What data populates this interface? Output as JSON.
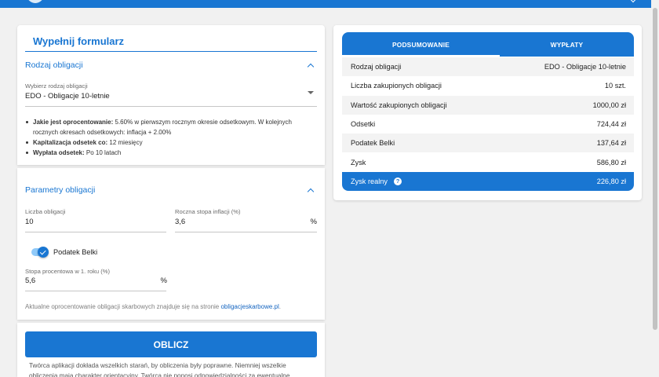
{
  "theme": {
    "primary": "#1976d2",
    "primary_light": "#90caf9",
    "page_background": "#f1f1f1",
    "link": "#1565c0"
  },
  "header": {
    "logo_icon": "logo-icon",
    "menu_icon": "chevron-down-icon"
  },
  "form": {
    "title": "Wypełnij formularz",
    "bond_type": {
      "title": "Rodzaj obligacji",
      "collapse_icon": "chevron-up-icon",
      "select": {
        "label": "Wybierz rodzaj obligacji",
        "value": "EDO - Obligacje 10-letnie",
        "icon": "dropdown-arrow-icon"
      },
      "info": [
        {
          "label": "Jakie jest oprocentowanie:",
          "value": "5.60% w pierwszym rocznym okresie odsetkowym. W kolejnych rocznych okresach odsetkowych: inflacja + 2.00%"
        },
        {
          "label": "Kapitalizacja odsetek co:",
          "value": "12 miesięcy"
        },
        {
          "label": "Wypłata odsetek:",
          "value": "Po 10 latach"
        }
      ]
    },
    "parameters": {
      "title": "Parametry obligacji",
      "collapse_icon": "chevron-up-icon",
      "quantity": {
        "label": "Liczba obligacji",
        "value": "10"
      },
      "inflation": {
        "label": "Roczna stopa inflacji (%)",
        "value": "3,6",
        "unit": "%"
      },
      "tax_toggle": {
        "label": "Podatek Belki",
        "checked": true
      },
      "first_year_rate": {
        "label": "Stopa procentowa w 1. roku (%)",
        "value": "5,6",
        "unit": "%"
      },
      "note": {
        "text": "Aktualne oprocentowanie obligacji skarbowych znajduje się na stronie ",
        "link": "obligacjeskarbowe.pl",
        "end": "."
      }
    },
    "submit_label": "OBLICZ",
    "disclaimer": [
      "Twórca aplikacji dokłada wszelkich starań, by obliczenia były poprawne. Niemniej wszelkie",
      "obliczenia mają charakter orientacyjny. Twórca nie ponosi odpowiedzialności za ewentualne"
    ]
  },
  "summary": {
    "tabs": [
      {
        "label": "PODSUMOWANIE",
        "active": true
      },
      {
        "label": "WYPŁATY",
        "active": false
      }
    ],
    "rows": [
      {
        "label": "Rodzaj obligacji",
        "value": "EDO - Obligacje 10-letnie"
      },
      {
        "label": "Liczba zakupionych obligacji",
        "value": "10 szt."
      },
      {
        "label": "Wartość zakupionych obligacji",
        "value": "1000,00 zł"
      },
      {
        "label": "Odsetki",
        "value": "724,44 zł"
      },
      {
        "label": "Podatek Belki",
        "value": "137,64 zł"
      },
      {
        "label": "Zysk",
        "value": "586,80 zł"
      }
    ],
    "total": {
      "label": "Zysk realny",
      "value": "226,80 zł",
      "icon": "help-icon"
    }
  }
}
